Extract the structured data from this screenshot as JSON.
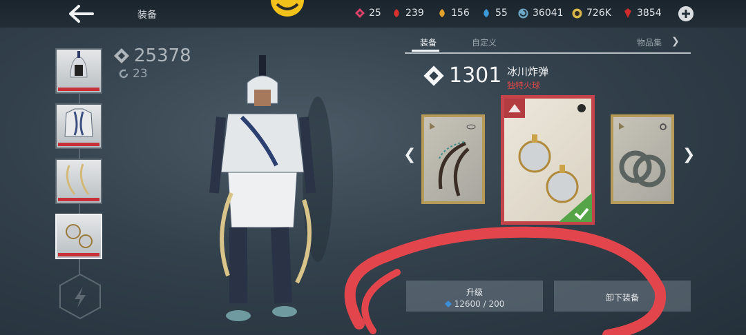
{
  "header": {
    "title": "装备",
    "resources": [
      {
        "icon": "pink-diamond-icon",
        "value": "25",
        "color": "#e0416a"
      },
      {
        "icon": "red-leaf-icon",
        "value": "239",
        "color": "#d8322e"
      },
      {
        "icon": "gold-leaf-icon",
        "value": "156",
        "color": "#e2a12a"
      },
      {
        "icon": "blue-leaf-icon",
        "value": "55",
        "color": "#3c9ad8"
      },
      {
        "icon": "spiral-orb-icon",
        "value": "36041",
        "color": "#6fa9c8"
      },
      {
        "icon": "gold-coin-icon",
        "value": "726K",
        "color": "#d8b64a"
      },
      {
        "icon": "ruby-gem-icon",
        "value": "3854",
        "color": "#d02b2b"
      }
    ]
  },
  "character": {
    "power": "25378",
    "level": "23"
  },
  "tabs": [
    {
      "label": "装备"
    },
    {
      "label": "自定义"
    },
    {
      "label": "物品集"
    }
  ],
  "item": {
    "power": "1301",
    "name": "冰川炸弹",
    "tag": "独特火球"
  },
  "actions": {
    "upgrade_label": "升级",
    "upgrade_cost": "12600 / 200",
    "unequip_label": "卸下装备"
  },
  "colors": {
    "accent_red": "#c4444a",
    "rarity_gold": "#b89a58",
    "equipped_green": "#55a447",
    "annotation_red": "#e2454b"
  }
}
